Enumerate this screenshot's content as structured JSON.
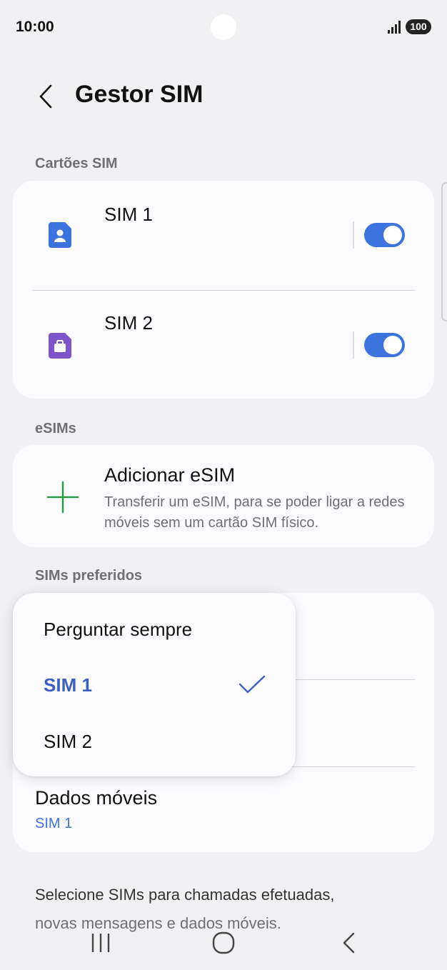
{
  "status_bar": {
    "time": "10:00",
    "battery": "100",
    "signal_icon": "signal-bars-icon"
  },
  "header": {
    "title": "Gestor SIM",
    "back_icon": "chevron-left-icon"
  },
  "sim_cards": {
    "section_label": "Cartões SIM",
    "items": [
      {
        "name": "SIM 1",
        "icon": "sim-card-person-icon",
        "icon_color": "#3d73dd",
        "enabled": true
      },
      {
        "name": "SIM 2",
        "icon": "sim-card-briefcase-icon",
        "icon_color": "#7c55c9",
        "enabled": true
      }
    ]
  },
  "esims": {
    "section_label": "eSIMs",
    "add_title": "Adicionar eSIM",
    "add_description": "Transferir um eSIM, para se poder ligar a redes móveis sem um cartão SIM físico.",
    "plus_icon_color": "#2e9a4e"
  },
  "preferred": {
    "section_label": "SIMs preferidos",
    "mobile_data_label": "Dados móveis",
    "mobile_data_value": "SIM 1"
  },
  "dropdown": {
    "options": [
      {
        "label": "Perguntar sempre",
        "selected": false
      },
      {
        "label": "SIM 1",
        "selected": true
      },
      {
        "label": "SIM 2",
        "selected": false
      }
    ]
  },
  "footer": {
    "line1": "Selecione SIMs para chamadas efetuadas,",
    "line2": "novas mensagens e dados móveis."
  },
  "nav_bar": {
    "recents_icon": "recents-icon",
    "home_icon": "home-icon",
    "back_icon": "back-icon"
  },
  "colors": {
    "accent": "#3d73dd",
    "background": "#f1f1f3",
    "card": "#fcfcfe"
  }
}
